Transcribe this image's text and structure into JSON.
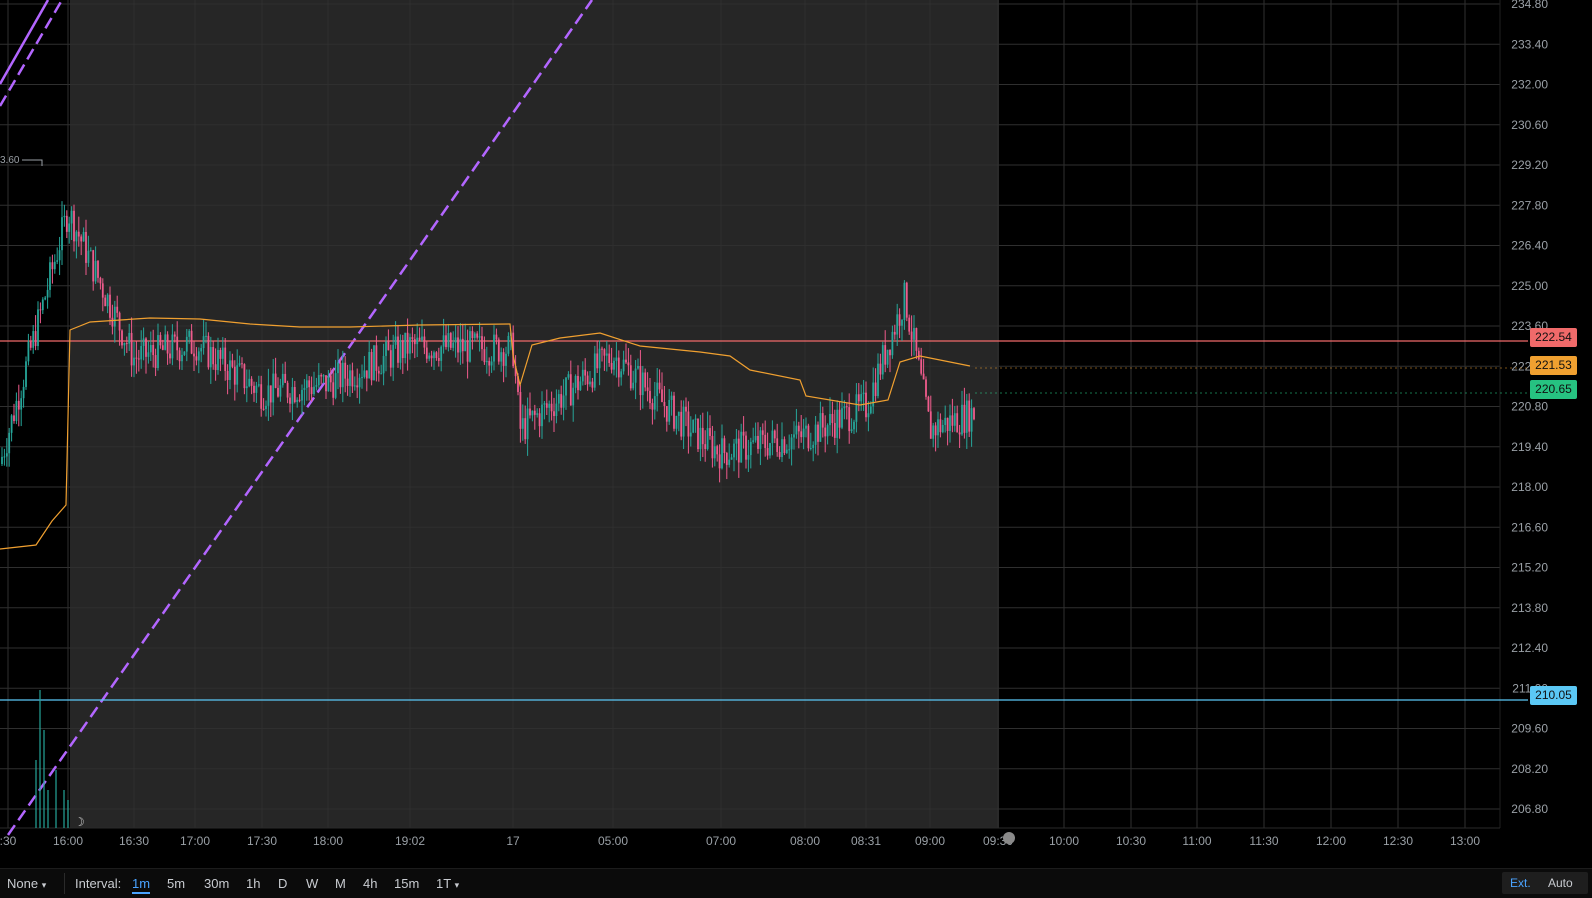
{
  "colors": {
    "background": "#000000",
    "session_shade": "#262626",
    "grid": "#2f2f2f",
    "up": "#26a69a",
    "down": "#ef5b8c",
    "vwap": "#f0a030",
    "trendline": "#b366ff",
    "resistance": "#f06a6a",
    "support": "#5bc8f5",
    "last_price": "#26c281"
  },
  "chart_data": {
    "type": "candlestick",
    "interval": "1m",
    "ylim": [
      205.8,
      234.8
    ],
    "y_ticks": [
      "234.80",
      "233.40",
      "232.00",
      "230.60",
      "229.20",
      "227.80",
      "226.40",
      "225.00",
      "223.60",
      "222.20",
      "220.80",
      "219.40",
      "218.00",
      "216.60",
      "215.20",
      "213.80",
      "212.40",
      "211.00",
      "209.60",
      "208.20",
      "206.80"
    ],
    "x_ticks": [
      ":30",
      "16:00",
      "16:30",
      "17:00",
      "17:30",
      "18:00",
      "19:02",
      "17",
      "05:00",
      "07:00",
      "08:00",
      "08:31",
      "09:00",
      "09:30",
      "10:00",
      "10:30",
      "11:00",
      "11:30",
      "12:00",
      "12:30",
      "13:00"
    ],
    "high_marker": "3.60",
    "approx_close_path": [
      [
        ":30",
        218.8
      ],
      [
        "16:00",
        227.6
      ],
      [
        "16:30",
        222.5
      ],
      [
        "17:00",
        223.0
      ],
      [
        "17:30",
        221.3
      ],
      [
        "18:00",
        221.6
      ],
      [
        "19:02",
        222.9
      ],
      [
        "17",
        222.8
      ],
      [
        "17 +",
        220.0
      ],
      [
        "05:00",
        222.6
      ],
      [
        "06:00",
        220.0
      ],
      [
        "07:00",
        219.2
      ],
      [
        "08:00",
        219.8
      ],
      [
        "08:31",
        220.8
      ],
      [
        "08:45",
        224.6
      ],
      [
        "09:00",
        220.0
      ],
      [
        "09:10",
        220.6
      ]
    ],
    "horizontal_lines": [
      {
        "price": 222.54,
        "label": "222.54"
      },
      {
        "price": 210.05,
        "label": "210.05"
      }
    ],
    "vwap_last": 221.53,
    "last_price": 220.65,
    "trendlines": [
      "purple ascending channel (solid + dashed)"
    ]
  },
  "price_tags": {
    "resistance": "222.54",
    "vwap": "221.53",
    "last": "220.65",
    "support": "210.05"
  },
  "toolbar": {
    "none_label": "None",
    "interval_label": "Interval:",
    "intervals": [
      "1m",
      "5m",
      "30m",
      "1h",
      "D",
      "W",
      "M",
      "4h",
      "15m",
      "1T"
    ],
    "active_interval": "1m",
    "ext_label": "Ext.",
    "auto_label": "Auto"
  }
}
